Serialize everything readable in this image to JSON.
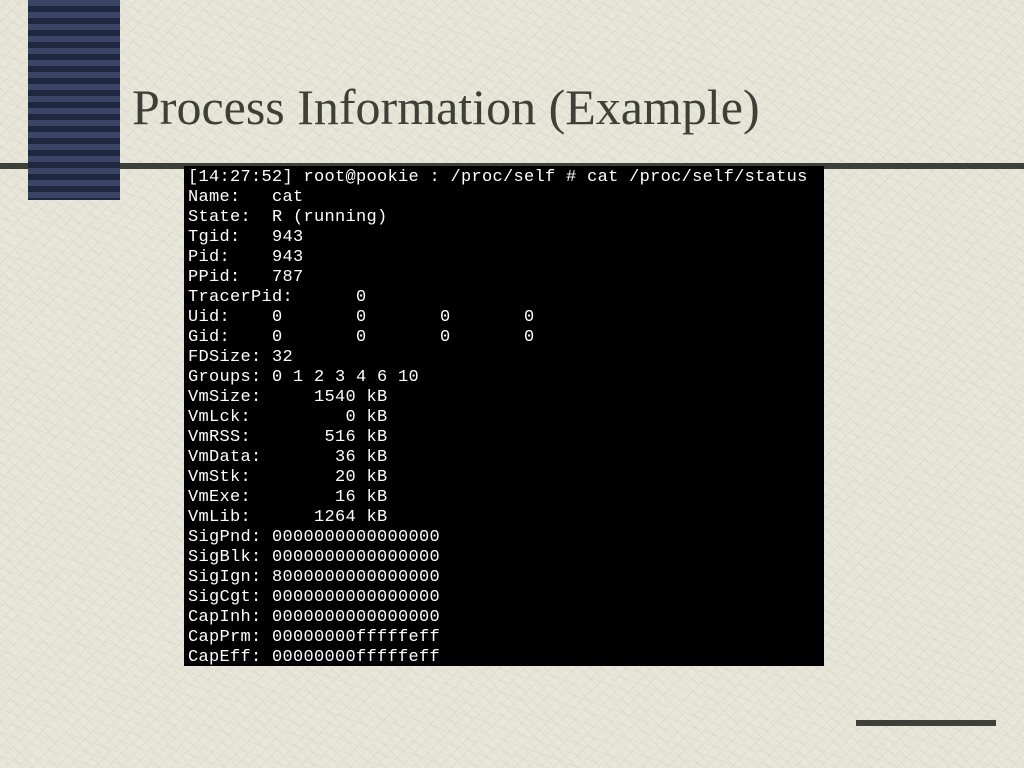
{
  "title": "Process Information (Example)",
  "terminal": {
    "prompt": "[14:27:52] root@pookie : /proc/self # cat /proc/self/status",
    "lines": [
      "Name:   cat",
      "State:  R (running)",
      "Tgid:   943",
      "Pid:    943",
      "PPid:   787",
      "TracerPid:      0",
      "Uid:    0       0       0       0",
      "Gid:    0       0       0       0",
      "FDSize: 32",
      "Groups: 0 1 2 3 4 6 10",
      "VmSize:     1540 kB",
      "VmLck:         0 kB",
      "VmRSS:       516 kB",
      "VmData:       36 kB",
      "VmStk:        20 kB",
      "VmExe:        16 kB",
      "VmLib:      1264 kB",
      "SigPnd: 0000000000000000",
      "SigBlk: 0000000000000000",
      "SigIgn: 8000000000000000",
      "SigCgt: 0000000000000000",
      "CapInh: 0000000000000000",
      "CapPrm: 00000000fffffeff",
      "CapEff: 00000000fffffeff"
    ]
  }
}
